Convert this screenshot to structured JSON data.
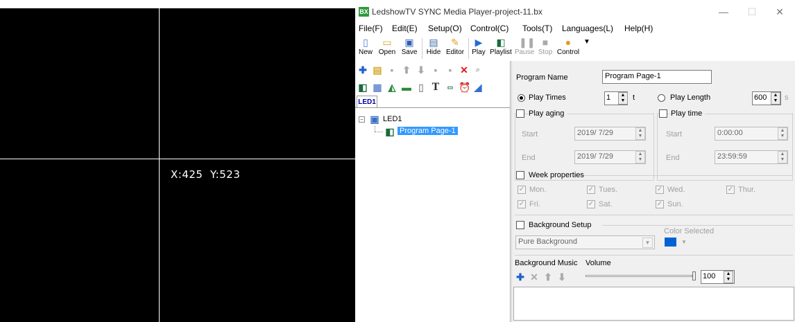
{
  "coords": {
    "x": "X:425",
    "y": "Y:523"
  },
  "window": {
    "title": "LedshowTV SYNC Media Player-project-11.bx",
    "app_icon": "BX"
  },
  "menu": [
    "File(F)",
    "Edit(E)",
    "Setup(O)",
    "Control(C)",
    "Tools(T)",
    "Languages(L)",
    "Help(H)"
  ],
  "toolbar": {
    "new": "New",
    "open": "Open",
    "save": "Save",
    "hide": "Hide",
    "editor": "Editor",
    "play": "Play",
    "playlist": "Playlist",
    "pause": "Pause",
    "stop": "Stop",
    "control": "Control"
  },
  "tree": {
    "tab": "LED1",
    "root": "LED1",
    "child": "Program Page-1"
  },
  "props": {
    "program_name_label": "Program Name",
    "program_name_value": "Program Page-1",
    "play_times_label": "Play Times",
    "play_times_value": "1",
    "play_times_unit": "t",
    "play_length_label": "Play Length",
    "play_length_value": "600",
    "play_length_unit": "s",
    "play_aging": "Play aging",
    "play_time": "Play time",
    "start_label": "Start",
    "end_label": "End",
    "start_date": "2019/ 7/29",
    "end_date": "2019/ 7/29",
    "start_time": "0:00:00",
    "end_time": "23:59:59",
    "week_properties": "Week properties",
    "days": [
      "Mon.",
      "Tues.",
      "Wed.",
      "Thur.",
      "Fri.",
      "Sat.",
      "Sun."
    ],
    "background_setup": "Background Setup",
    "color_selected": "Color Selected",
    "background_type": "Pure Background",
    "background_color": "#0063d4",
    "background_music": "Background Music",
    "volume_label": "Volume",
    "volume_value": "100"
  }
}
